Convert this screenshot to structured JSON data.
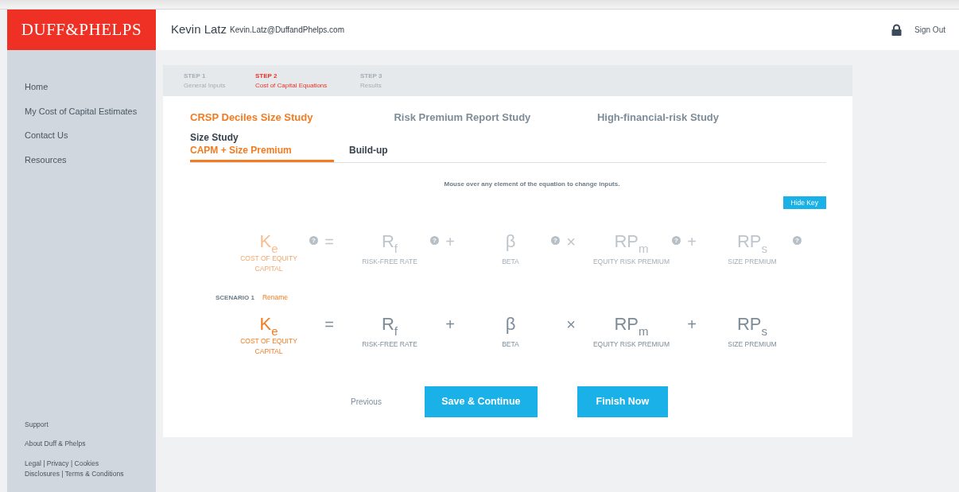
{
  "header": {
    "logo": "DUFF&PHELPS",
    "user_name": "Kevin Latz",
    "user_email": "Kevin.Latz@DuffandPhelps.com",
    "sign_out": "Sign Out"
  },
  "sidebar": {
    "items": [
      "Home",
      "My Cost of Capital Estimates",
      "Contact Us",
      "Resources"
    ],
    "footer_links": [
      "Support",
      "About Duff & Phelps"
    ],
    "legal": [
      "Legal | Privacy | Cookies",
      "Disclosures | Terms & Conditions"
    ]
  },
  "steps": [
    {
      "label": "STEP 1",
      "caption": "General Inputs",
      "selected": false
    },
    {
      "label": "STEP 2",
      "caption": "Cost of Capital Equations",
      "selected": true
    },
    {
      "label": "STEP 3",
      "caption": "Results",
      "selected": false
    }
  ],
  "study_tabs": [
    {
      "label": "CRSP Deciles Size Study",
      "selected": true
    },
    {
      "label": "Risk Premium Report Study",
      "selected": false
    },
    {
      "label": "High-financial-risk Study",
      "selected": false
    }
  ],
  "size_study": {
    "title": "Size Study",
    "tabs": [
      {
        "label": "CAPM + Size Premium",
        "selected": true
      },
      {
        "label": "Build-up",
        "selected": false
      }
    ]
  },
  "hint": "Mouse over any element of the equation to change inputs.",
  "hide_key_button": "Hide Key",
  "key_equation": [
    {
      "kind": "result",
      "symbol": "K$_{e}$",
      "caption": "COST OF EQUITY CAPITAL",
      "help": "?"
    },
    {
      "kind": "operator",
      "symbol": "="
    },
    {
      "kind": "input",
      "symbol": "R$_{f}$",
      "caption": "RISK-FREE RATE",
      "help": "?"
    },
    {
      "kind": "operator",
      "symbol": "+"
    },
    {
      "kind": "input",
      "symbol": "β",
      "caption": "BETA",
      "help": "?"
    },
    {
      "kind": "operator",
      "symbol": "×"
    },
    {
      "kind": "input",
      "symbol": "RP$_{m}$",
      "caption": "EQUITY RISK PREMIUM",
      "help": "?"
    },
    {
      "kind": "operator",
      "symbol": "+"
    },
    {
      "kind": "input",
      "symbol": "RP$_{s}$",
      "caption": "SIZE PREMIUM",
      "help": "?"
    }
  ],
  "scenario": {
    "label": "SCENARIO 1",
    "rename": "Rename",
    "equation": [
      {
        "kind": "result",
        "symbol": "K$_{e}$",
        "caption": "COST OF EQUITY CAPITAL"
      },
      {
        "kind": "operator",
        "symbol": "="
      },
      {
        "kind": "input",
        "symbol": "R$_{f}$",
        "caption": "RISK-FREE RATE"
      },
      {
        "kind": "operator",
        "symbol": "+"
      },
      {
        "kind": "input",
        "symbol": "β",
        "caption": "BETA"
      },
      {
        "kind": "operator",
        "symbol": "×"
      },
      {
        "kind": "input",
        "symbol": "RP$_{m}$",
        "caption": "EQUITY RISK PREMIUM"
      },
      {
        "kind": "operator",
        "symbol": "+"
      },
      {
        "kind": "input",
        "symbol": "RP$_{s}$",
        "caption": "SIZE PREMIUM"
      }
    ]
  },
  "actions": {
    "previous": "Previous",
    "save": "Save & Continue",
    "finish": "Finish Now"
  }
}
